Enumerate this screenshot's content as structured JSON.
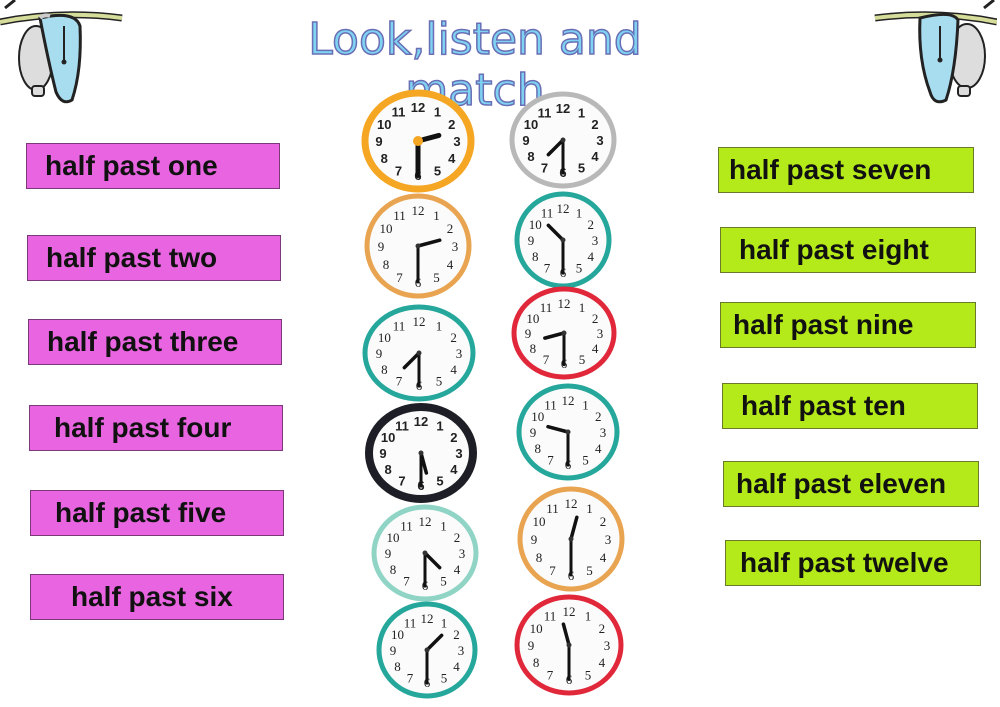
{
  "title": "Look,listen and match",
  "colors": {
    "pink": "#e864e0",
    "green": "#b5ea1a",
    "title": "#7fd3f2"
  },
  "left_labels": [
    {
      "text": "half past one"
    },
    {
      "text": "half past two"
    },
    {
      "text": "half past three"
    },
    {
      "text": "half past four"
    },
    {
      "text": "half past five"
    },
    {
      "text": "half past six"
    }
  ],
  "right_labels": [
    {
      "text": "half past seven"
    },
    {
      "text": "half past eight"
    },
    {
      "text": "half past nine"
    },
    {
      "text": "half past ten"
    },
    {
      "text": "half past eleven"
    },
    {
      "text": "half past twelve"
    }
  ],
  "clocks": [
    {
      "column": "left",
      "hour": 2,
      "minute": 30,
      "rim": "#f5a623"
    },
    {
      "column": "right",
      "hour": 7,
      "minute": 30,
      "rim": "#b8b8b8"
    },
    {
      "column": "left",
      "hour": 2,
      "minute": 30,
      "rim": "#e8a450"
    },
    {
      "column": "right",
      "hour": 10,
      "minute": 30,
      "rim": "#25a79c"
    },
    {
      "column": "left",
      "hour": 7,
      "minute": 30,
      "rim": "#25a79c"
    },
    {
      "column": "right",
      "hour": 8,
      "minute": 30,
      "rim": "#e0283a"
    },
    {
      "column": "left",
      "hour": 5,
      "minute": 30,
      "rim": "#1e1e26"
    },
    {
      "column": "right",
      "hour": 9,
      "minute": 30,
      "rim": "#25a79c"
    },
    {
      "column": "left",
      "hour": 4,
      "minute": 30,
      "rim": "#8fd4c4"
    },
    {
      "column": "right",
      "hour": 12,
      "minute": 30,
      "rim": "#e8a450"
    },
    {
      "column": "left",
      "hour": 1,
      "minute": 30,
      "rim": "#25a79c"
    },
    {
      "column": "right",
      "hour": 11,
      "minute": 30,
      "rim": "#e0283a"
    }
  ],
  "numerals": [
    "12",
    "1",
    "2",
    "3",
    "4",
    "5",
    "6",
    "7",
    "8",
    "9",
    "10",
    "11"
  ]
}
